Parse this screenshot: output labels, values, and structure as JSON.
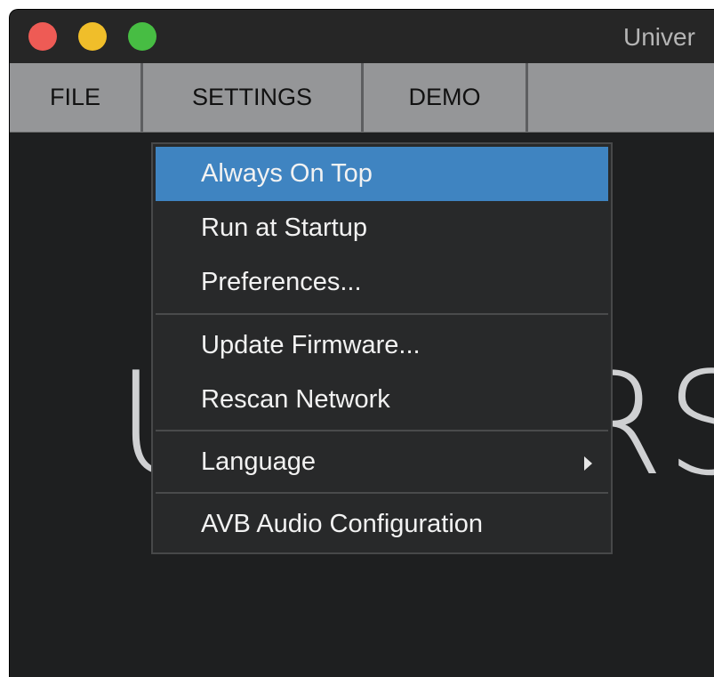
{
  "window": {
    "title": "Univer"
  },
  "menubar": {
    "items": [
      {
        "label": "FILE"
      },
      {
        "label": "SETTINGS"
      },
      {
        "label": "DEMO"
      }
    ]
  },
  "background": {
    "logo_text": "UNIVERSAL"
  },
  "settings_menu": {
    "items": [
      {
        "label": "Always On Top",
        "selected": true
      },
      {
        "label": "Run at Startup"
      },
      {
        "label": "Preferences..."
      },
      {
        "label": "Update Firmware..."
      },
      {
        "label": "Rescan Network"
      },
      {
        "label": "Language",
        "has_submenu": true
      },
      {
        "label": "AVB Audio Configuration"
      }
    ]
  },
  "colors": {
    "highlight": "#3f84c1",
    "menubar": "#959698",
    "window_bg": "#1e1f20",
    "close": "#ee5b55",
    "minimize": "#f0be2a",
    "zoom": "#47bd43"
  }
}
